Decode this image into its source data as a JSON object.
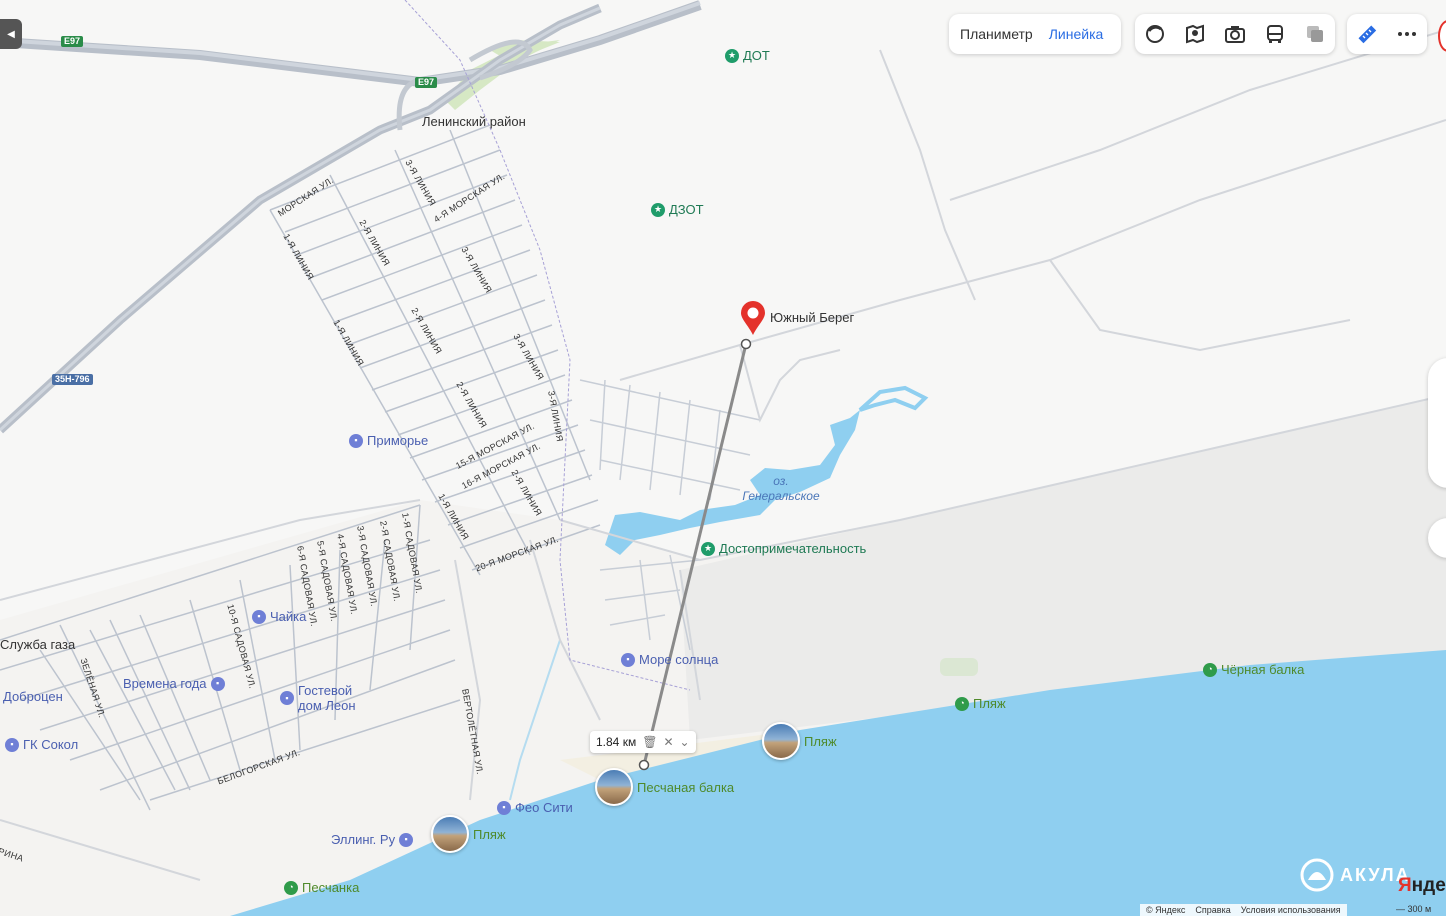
{
  "toolbar": {
    "planimeter_label": "Планиметр",
    "ruler_label": "Линейка",
    "icons": [
      "layers-icon",
      "panorama-icon",
      "photo-icon",
      "transit-icon",
      "traffic-icon",
      "ruler-icon",
      "more-icon"
    ]
  },
  "roads": {
    "e97_a": "E97",
    "e97_b": "E97",
    "regional": "35Н-796"
  },
  "places": {
    "district": "Ленинский район",
    "dot": "ДОТ",
    "dzot": "ДЗОТ",
    "yuzhny_bereg": "Южный Берег",
    "primorye": "Приморье",
    "lake": "оз. Генеральское",
    "landmark": "Достопримечательность",
    "chayka": "Чайка",
    "gas_service": "Служба газа",
    "dobrotsen": "Доброцен",
    "vremena_goda": "Времена года",
    "guest_house": "Гостевой дом Леон",
    "gk_sokol": "ГК Сокол",
    "more_solntsa": "Море солнца",
    "chernaya_balka": "Чёрная балка",
    "beach_1": "Пляж",
    "beach_2": "Пляж",
    "peschanaya_balka": "Песчаная балка",
    "feo_city": "Фео Сити",
    "elling": "Эллинг. Ру",
    "beach_3": "Пляж",
    "peschanka": "Песчанка"
  },
  "streets": {
    "morskaya": "МОРСКАЯ УЛ.",
    "line3a": "3-Я ЛИНИЯ",
    "morskaya4": "4-Я МОРСКАЯ УЛ.",
    "line1a": "1-Я ЛИНИЯ",
    "line2a": "2-Я ЛИНИЯ",
    "line3b": "3-Я ЛИНИЯ",
    "line1b": "1-Я ЛИНИЯ",
    "line2b": "2-Я ЛИНИЯ",
    "line3c": "3-Я ЛИНИЯ",
    "line2c": "2-Я ЛИНИЯ",
    "line3d": "3-Я ЛИНИЯ",
    "morskaya15": "15-Я МОРСКАЯ УЛ.",
    "morskaya16": "16-Я МОРСКАЯ УЛ.",
    "line2d": "2-Я ЛИНИЯ",
    "line1c": "1-Я ЛИНИЯ",
    "morskaya20": "20-Я МОРСКАЯ УЛ.",
    "sad1": "1-Я САДОВАЯ УЛ.",
    "sad2": "2-Я САДОВАЯ УЛ.",
    "sad3": "3-Я САДОВАЯ УЛ.",
    "sad4": "4-Я САДОВАЯ УЛ.",
    "sad5": "5-Я САДОВАЯ УЛ.",
    "sad6": "6-Я САДОВАЯ УЛ.",
    "sad10": "10-Я САДОВАЯ УЛ.",
    "zelenaya": "ЗЕЛЁНАЯ УЛ.",
    "vertoletnaya": "ВЕРТОЛЁТНАЯ УЛ.",
    "belogorskaya": "БЕЛОГОРСКАЯ УЛ.",
    "rina": "РИНА"
  },
  "measurement": {
    "distance": "1.84 км"
  },
  "brand": {
    "watermark": "АКУЛА",
    "logo_a": "Я",
    "logo_b": "нде"
  },
  "footer": {
    "copyright": "© Яндекс",
    "help": "Справка",
    "terms": "Условия использования",
    "scale": "300 м"
  },
  "colors": {
    "sea": "#8fcff0",
    "lake": "#8fcff0",
    "park": "#dde9cf",
    "accent": "#2a6de3",
    "marker": "#e4322b"
  }
}
